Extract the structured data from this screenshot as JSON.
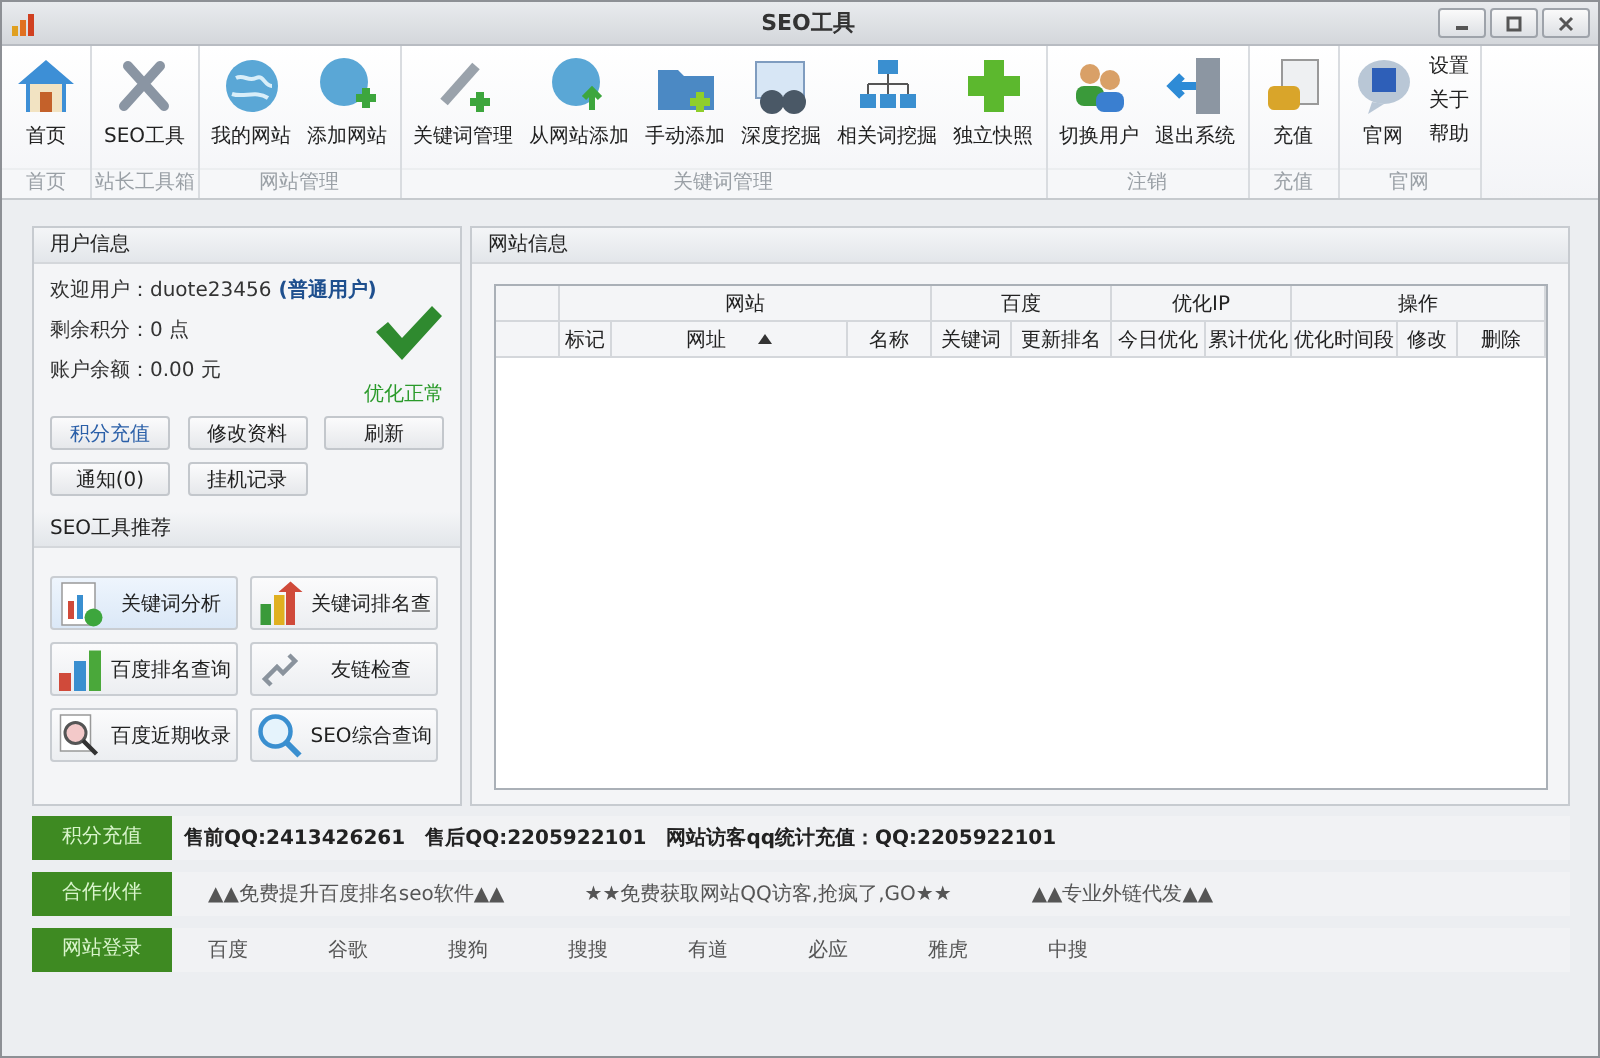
{
  "window": {
    "title": "SEO工具"
  },
  "ribbon": {
    "groups": [
      {
        "label": "首页",
        "buttons": [
          "首页"
        ]
      },
      {
        "label": "站长工具箱",
        "buttons": [
          "SEO工具"
        ]
      },
      {
        "label": "网站管理",
        "buttons": [
          "我的网站",
          "添加网站"
        ]
      },
      {
        "label": "关键词管理",
        "buttons": [
          "关键词管理",
          "从网站添加",
          "手动添加",
          "深度挖掘",
          "相关词挖掘",
          "独立快照"
        ]
      },
      {
        "label": "注销",
        "buttons": [
          "切换用户",
          "退出系统"
        ]
      },
      {
        "label": "充值",
        "buttons": [
          "充值"
        ]
      },
      {
        "label": "官网",
        "buttons": [
          "官网"
        ],
        "links": [
          "设置",
          "关于",
          "帮助"
        ]
      }
    ]
  },
  "user_info": {
    "title": "用户信息",
    "welcome": "欢迎用户：duote23456",
    "user_type": "(普通用户)",
    "points": "剩余积分：0 点",
    "balance": "账户余额：0.00 元",
    "status": "优化正常",
    "buttons": [
      {
        "label": "积分充值",
        "selected": true
      },
      {
        "label": "修改资料",
        "selected": false
      },
      {
        "label": "刷新",
        "selected": false
      },
      {
        "label": "通知(0)",
        "selected": false
      },
      {
        "label": "挂机记录",
        "selected": false
      }
    ]
  },
  "seo_tools": {
    "title": "SEO工具推荐",
    "items": [
      {
        "label": "关键词分析",
        "selected": true
      },
      {
        "label": "关键词排名查",
        "selected": false
      },
      {
        "label": "百度排名查询",
        "selected": false
      },
      {
        "label": "友链检查",
        "selected": false
      },
      {
        "label": "百度近期收录",
        "selected": false
      },
      {
        "label": "SEO综合查询",
        "selected": false
      }
    ]
  },
  "site_info": {
    "title": "网站信息",
    "table": {
      "header_groups": [
        {
          "label": "网站",
          "columns": [
            {
              "label": "标记",
              "sorted": false
            },
            {
              "label": "网址",
              "sorted": true
            },
            {
              "label": "名称",
              "sorted": false
            }
          ]
        },
        {
          "label": "百度",
          "columns": [
            {
              "label": "关键词",
              "sorted": false
            },
            {
              "label": "更新排名",
              "sorted": false
            }
          ]
        },
        {
          "label": "优化IP",
          "columns": [
            {
              "label": "今日优化",
              "sorted": false
            },
            {
              "label": "累计优化",
              "sorted": false
            }
          ]
        },
        {
          "label": "操作",
          "columns": [
            {
              "label": "优化时间段",
              "sorted": false
            },
            {
              "label": "修改",
              "sorted": false
            },
            {
              "label": "删除",
              "sorted": false
            }
          ]
        }
      ]
    }
  },
  "footer_rows": [
    {
      "label": "积分充值",
      "kind": "info",
      "items": [
        "售前QQ:2413426261",
        "售后QQ:2205922101",
        "网站访客qq统计充值：QQ:2205922101"
      ]
    },
    {
      "label": "合作伙伴",
      "kind": "links",
      "items": [
        "▲▲免费提升百度排名seo软件▲▲",
        "★★免费获取网站QQ访客,抢疯了,GO★★",
        "▲▲专业外链代发▲▲"
      ]
    },
    {
      "label": "网站登录",
      "kind": "links",
      "items": [
        "百度",
        "谷歌",
        "搜狗",
        "搜搜",
        "有道",
        "必应",
        "雅虎",
        "中搜"
      ]
    }
  ]
}
